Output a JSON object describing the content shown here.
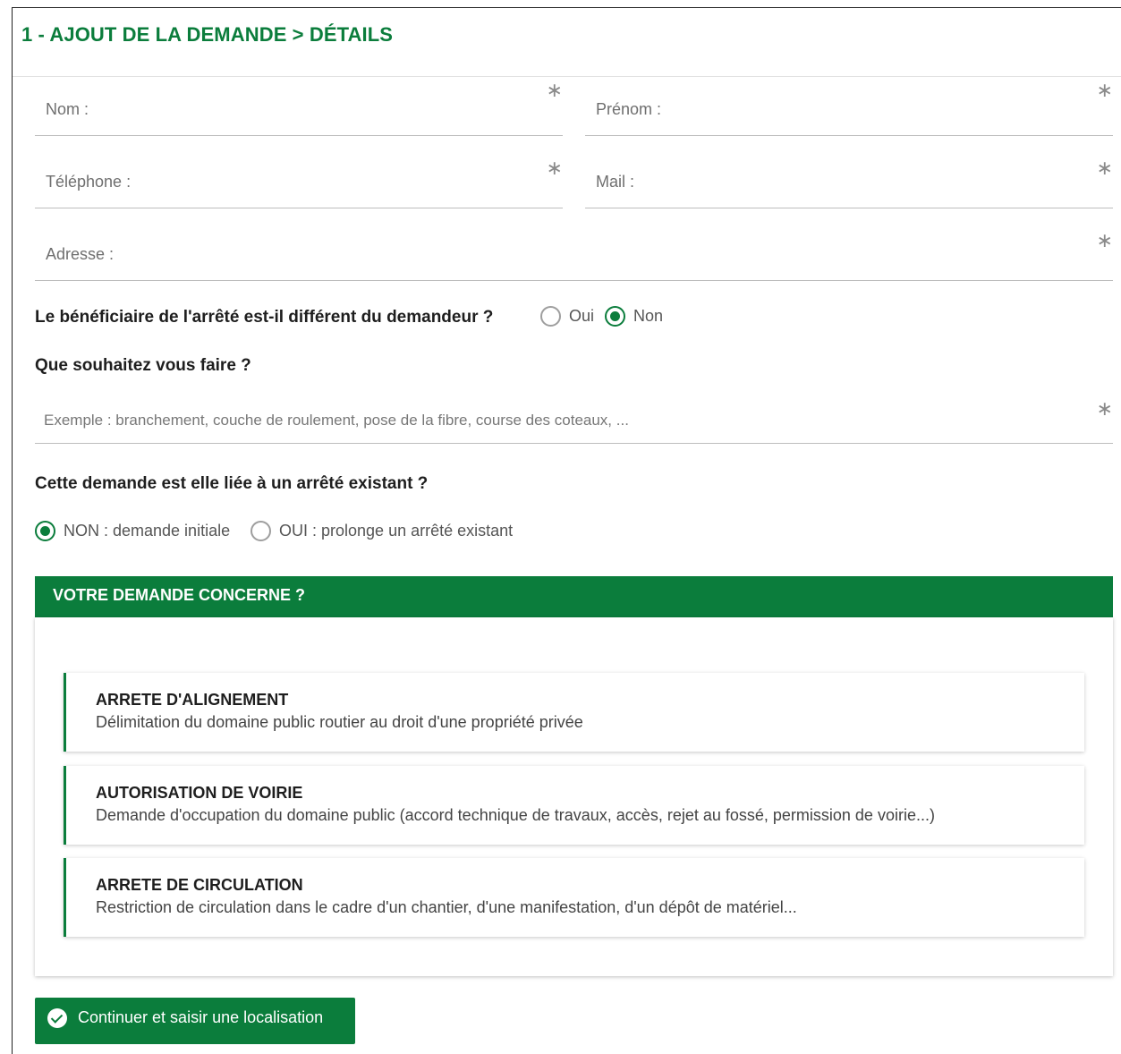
{
  "header": {
    "title": "1 - AJOUT DE LA DEMANDE > DÉTAILS",
    "more": "⋮"
  },
  "form": {
    "nom_label": "Nom :",
    "prenom_label": "Prénom :",
    "telephone_label": "Téléphone :",
    "mail_label": "Mail :",
    "adresse_label": "Adresse :",
    "required_mark": "∗"
  },
  "beneficiaire": {
    "question": "Le bénéficiaire de l'arrêté est-il différent du demandeur ?",
    "options": [
      {
        "label": "Oui",
        "selected": false
      },
      {
        "label": "Non",
        "selected": true
      }
    ]
  },
  "souhait": {
    "question": "Que souhaitez vous faire ?",
    "placeholder": "Exemple : branchement, couche de roulement, pose de la fibre, course des coteaux, ..."
  },
  "liaison": {
    "question": "Cette demande est elle liée à un arrêté existant ?",
    "options": [
      {
        "label": "NON : demande initiale",
        "selected": true
      },
      {
        "label": "OUI : prolonge un arrêté existant",
        "selected": false
      }
    ]
  },
  "concerne": {
    "title": "VOTRE DEMANDE CONCERNE ?",
    "cards": [
      {
        "title": "ARRETE D'ALIGNEMENT",
        "desc": "Délimitation du domaine public routier au droit d'une propriété privée"
      },
      {
        "title": "AUTORISATION DE VOIRIE",
        "desc": "Demande d'occupation du domaine public (accord technique de travaux, accès, rejet au fossé, permission de voirie...)"
      },
      {
        "title": "ARRETE DE CIRCULATION",
        "desc": "Restriction de circulation dans le cadre d'un chantier, d'une manifestation, d'un dépôt de matériel..."
      }
    ]
  },
  "continue_button": "Continuer et saisir une localisation",
  "colors": {
    "accent": "#0b7d3c"
  }
}
